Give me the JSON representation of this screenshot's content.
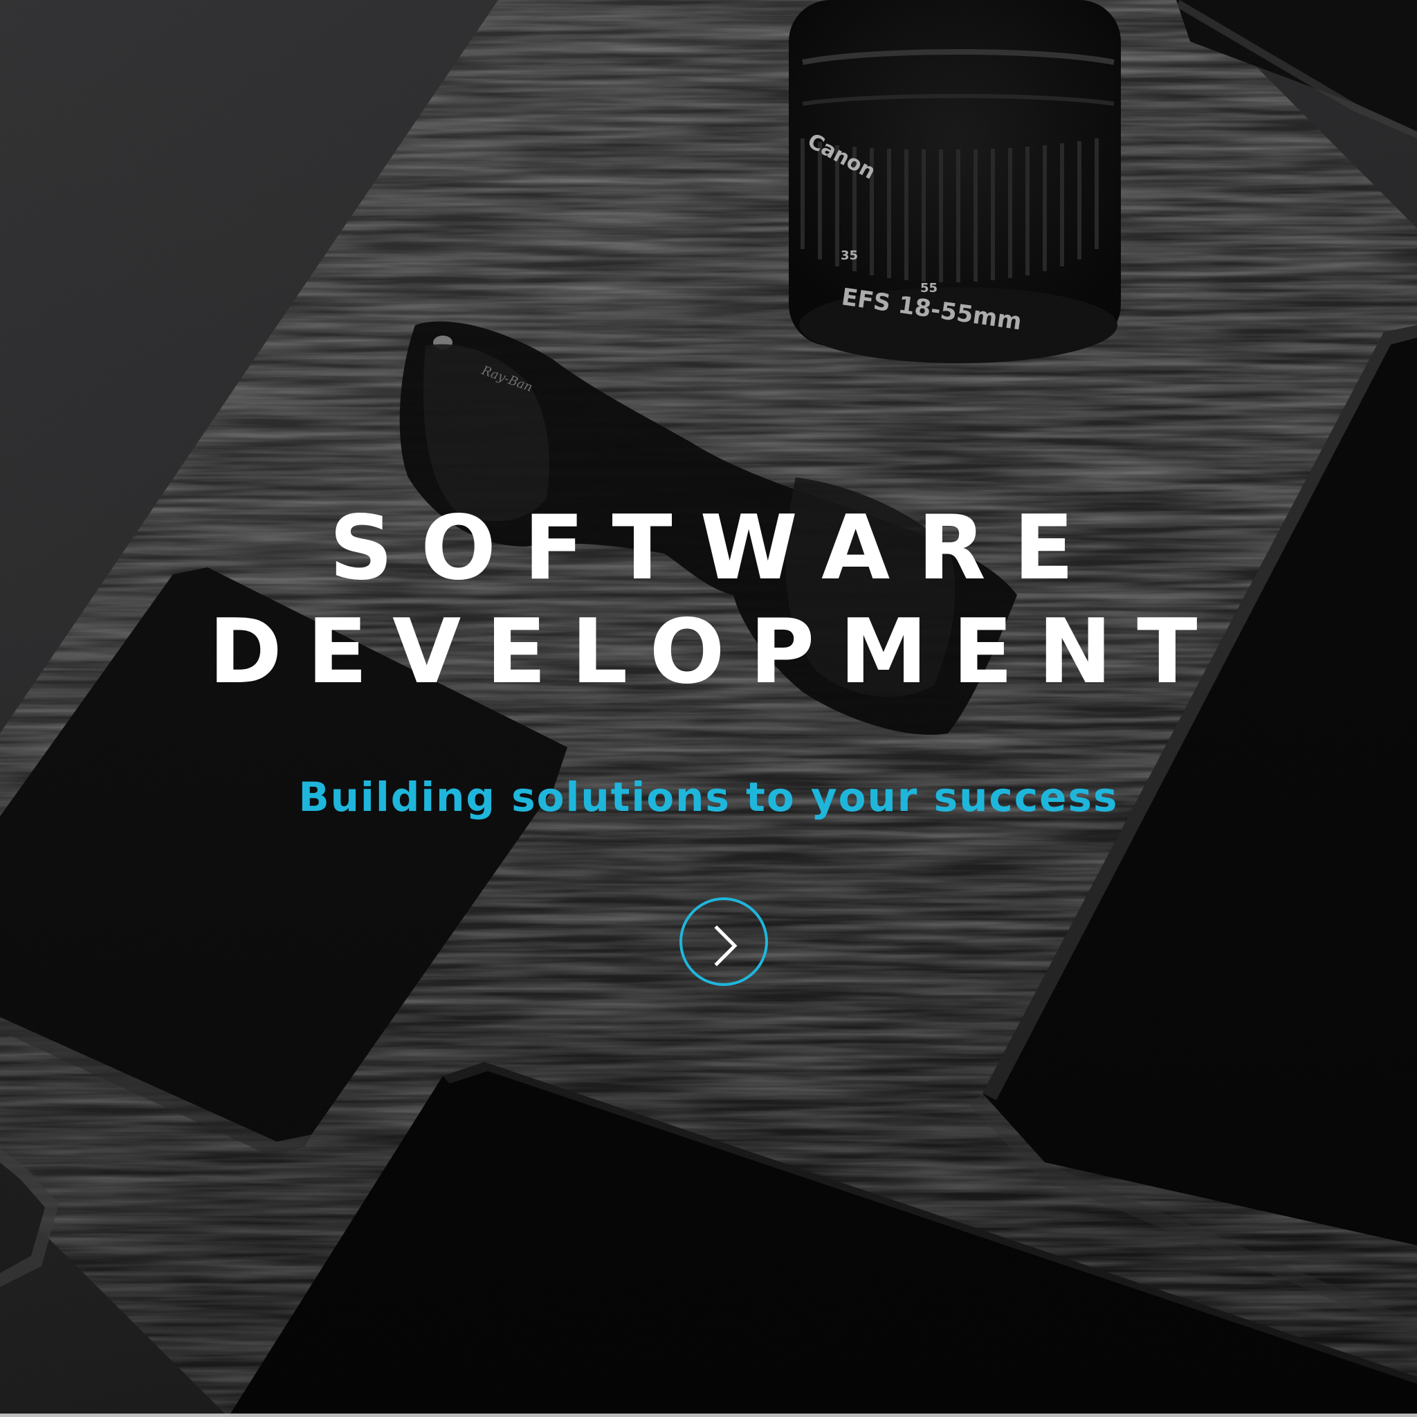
{
  "hero": {
    "title_line1": "SOFTWARE",
    "title_line2": "DEVELOPMENT",
    "subtitle": "Building solutions to your success",
    "next_button_icon": "chevron-right-icon"
  },
  "background": {
    "lens_brand": "Canon",
    "lens_spec": "EFS 18-55mm",
    "lens_mark_35": "35",
    "lens_mark_55": "55",
    "sunglasses_brand": "Ray-Ban"
  },
  "colors": {
    "accent": "#1fb6dc",
    "title": "#ffffff",
    "background": "#0a0a0a"
  }
}
